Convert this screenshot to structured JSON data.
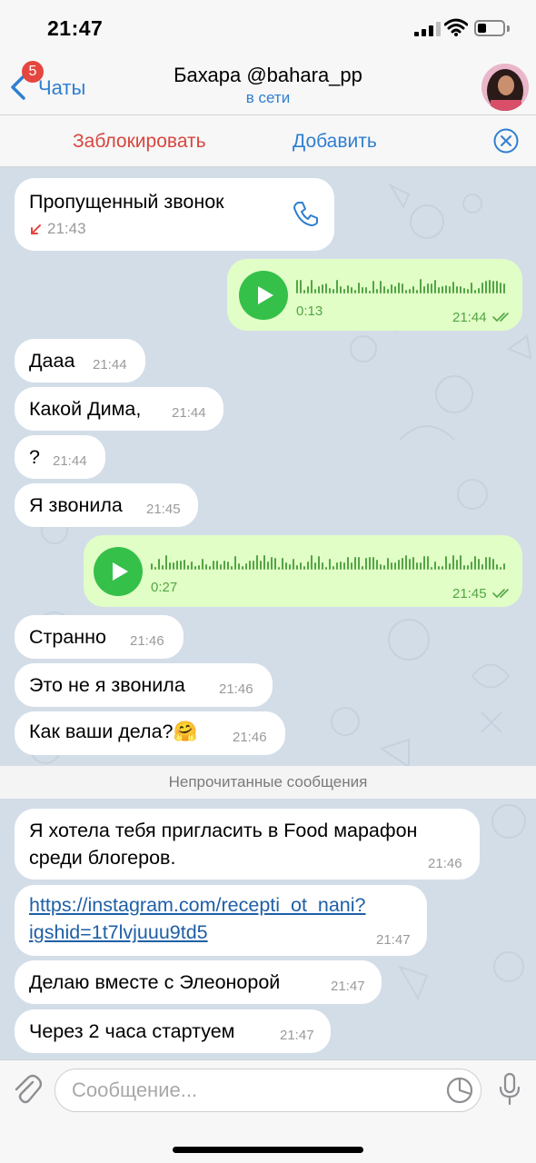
{
  "status_bar": {
    "time": "21:47"
  },
  "nav": {
    "back_label": "Чаты",
    "unread_badge": "5",
    "title": "Бахара @bahara_pp",
    "status": "в сети"
  },
  "actions": {
    "block": "Заблокировать",
    "add": "Добавить"
  },
  "messages": [
    {
      "type": "missed_call",
      "direction": "incoming",
      "text": "Пропущенный звонок",
      "time": "21:43"
    },
    {
      "type": "voice",
      "direction": "outgoing",
      "duration": "0:13",
      "time": "21:44",
      "read": true
    },
    {
      "type": "text",
      "direction": "incoming",
      "text": "Дааа",
      "time": "21:44"
    },
    {
      "type": "text",
      "direction": "incoming",
      "text": "Какой Дима,",
      "time": "21:44"
    },
    {
      "type": "text",
      "direction": "incoming",
      "text": "?",
      "time": "21:44"
    },
    {
      "type": "text",
      "direction": "incoming",
      "text": "Я звонила",
      "time": "21:45"
    },
    {
      "type": "voice",
      "direction": "outgoing",
      "duration": "0:27",
      "time": "21:45",
      "read": true
    },
    {
      "type": "text",
      "direction": "incoming",
      "text": "Странно",
      "time": "21:46"
    },
    {
      "type": "text",
      "direction": "incoming",
      "text": "Это не я звонила",
      "time": "21:46"
    },
    {
      "type": "text",
      "direction": "incoming",
      "text": "Как ваши дела?🤗",
      "time": "21:46"
    },
    {
      "type": "text",
      "direction": "incoming",
      "lines": [
        "Я хотела тебя пригласить в Food марафон",
        "среди блогеров."
      ],
      "time": "21:46"
    },
    {
      "type": "link",
      "direction": "incoming",
      "lines": [
        "https://instagram.com/recepti_ot_nani?",
        "igshid=1t7lvjuuu9td5"
      ],
      "time": "21:47"
    },
    {
      "type": "text",
      "direction": "incoming",
      "text": "Делаю вместе с Элеонорой",
      "time": "21:47"
    },
    {
      "type": "text",
      "direction": "incoming",
      "text": "Через 2 часа стартуем",
      "time": "21:47"
    }
  ],
  "unread_divider": "Непрочитанные сообщения",
  "input": {
    "placeholder": "Сообщение..."
  },
  "colors": {
    "accent": "#2f7fd1",
    "danger": "#d9463f",
    "outgoing_bubble": "#e1fec6",
    "incoming_bubble": "#ffffff",
    "chat_background": "#d3dde8",
    "play_button": "#35c04a"
  },
  "icons": [
    "back-chevron-icon",
    "phone-icon",
    "play-icon",
    "read-checkmarks-icon",
    "close-circle-icon",
    "attach-paperclip-icon",
    "sticker-icon",
    "microphone-icon",
    "signal-icon",
    "wifi-icon",
    "battery-icon"
  ]
}
